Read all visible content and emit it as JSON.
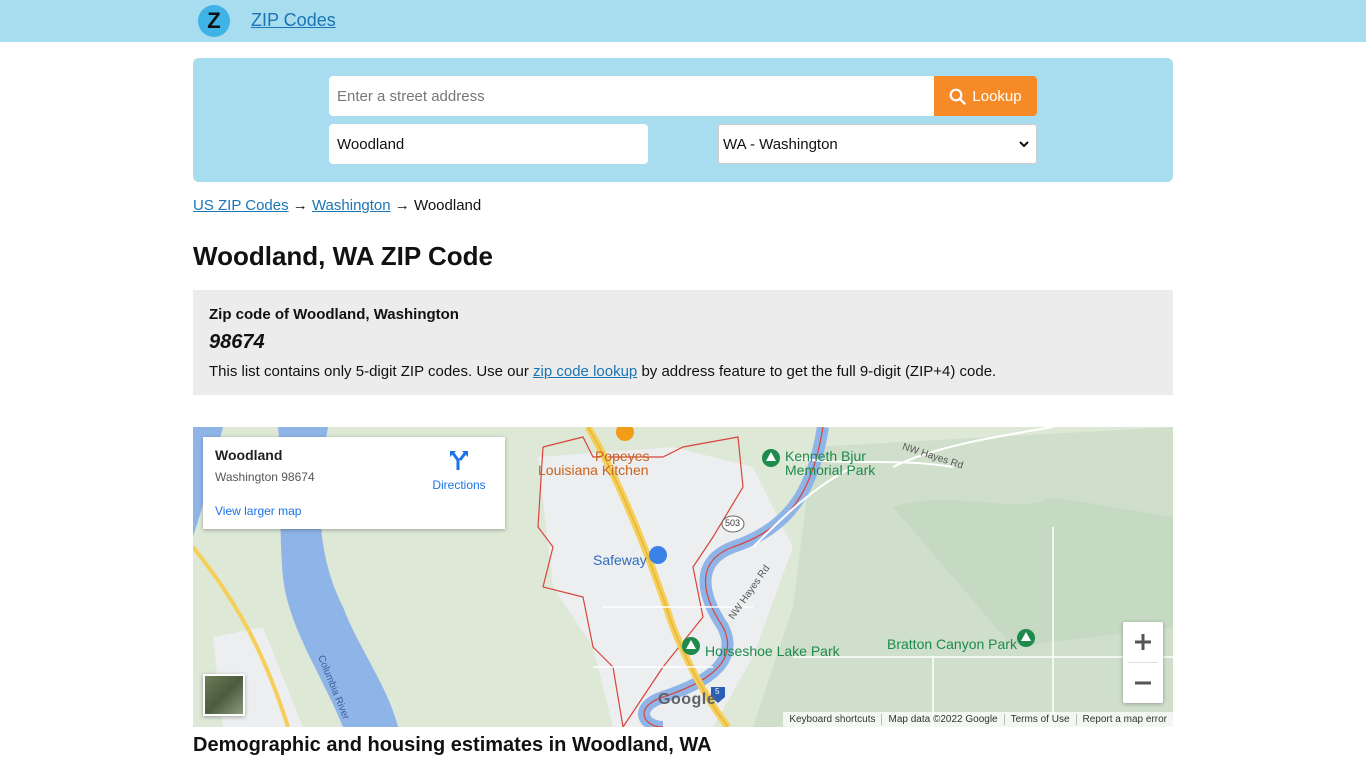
{
  "header": {
    "logo_letter": "Z",
    "site_title": "ZIP Codes"
  },
  "search": {
    "address_placeholder": "Enter a street address",
    "lookup_label": "Lookup",
    "city_value": "Woodland",
    "state_value": "WA - Washington"
  },
  "breadcrumb": {
    "items": [
      "US ZIP Codes",
      "Washington",
      "Woodland"
    ],
    "separator": "→"
  },
  "page_title": "Woodland, WA ZIP Code",
  "zip_box": {
    "heading": "Zip code of Woodland, Washington",
    "zip": "98674",
    "note_before": "This list contains only 5-digit ZIP codes. Use our ",
    "note_link": "zip code lookup",
    "note_after": " by address feature to get the full 9-digit (ZIP+4) code."
  },
  "map": {
    "card_title": "Woodland",
    "card_subtitle": "Washington 98674",
    "directions_label": "Directions",
    "larger_map_label": "View larger map",
    "labels": {
      "popeyes": "Popeyes",
      "louisiana": "Louisiana Kitchen",
      "kenneth": "Kenneth Bjur",
      "memorial": "Memorial Park",
      "safeway": "Safeway",
      "horseshoe": "Horseshoe Lake Park",
      "bratton": "Bratton Canyon Park",
      "hayes_rd": "NW Hayes Rd",
      "hayes_rd2": "NW Hayes Rd",
      "columbia": "Columbia River",
      "route_503": "503",
      "route_5": "5"
    },
    "google_logo": "Google",
    "attribution": [
      "Keyboard shortcuts",
      "Map data ©2022 Google",
      "Terms of Use",
      "Report a map error"
    ],
    "colors": {
      "water": "#8fb4e8",
      "land": "#dde8d6",
      "urban": "#eceef0",
      "boundary": "#d9443c",
      "highway": "#f6cf5a",
      "park_text": "#1e8a4b",
      "poi_text": "#c7631c"
    }
  },
  "section_title": "Demographic and housing estimates in Woodland, WA",
  "colors": {
    "topbar": "#a8dcef",
    "link": "#1a75b5",
    "lookup_button": "#f58a26",
    "zip_box_bg": "#ececec"
  }
}
